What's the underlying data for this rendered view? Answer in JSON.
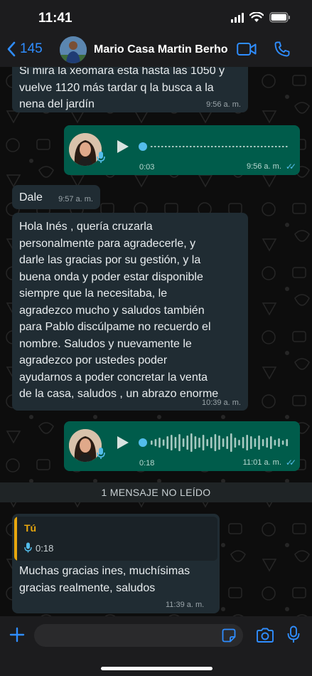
{
  "status_bar": {
    "time": "11:41"
  },
  "header": {
    "back_count": "145",
    "contact_name": "Mario Casa Martin Berho",
    "icons": [
      "back-chevron-icon",
      "video-call-icon",
      "phone-call-icon"
    ]
  },
  "messages": [
    {
      "type": "text",
      "direction": "incoming",
      "text": "Si mira la xeomara esta hasta las 1050 y\nvuelve 1120 más tardar q la busca a la\nnena del jardín",
      "time": "9:56 a. m."
    },
    {
      "type": "voice",
      "direction": "outgoing",
      "duration": "0:03",
      "time": "9:56 a. m.",
      "status": "read"
    },
    {
      "type": "text",
      "direction": "incoming",
      "text": "Dale",
      "time": "9:57 a. m."
    },
    {
      "type": "text",
      "direction": "incoming",
      "text": "Hola Inés , quería cruzarla\npersonalmente para agradecerle, y\ndarle las gracias por su gestión, y la\nbuena onda y poder estar disponible\nsiempre que la necesitaba, le\nagradezco mucho y saludos también\npara Pablo discúlpame no recuerdo el\nnombre. Saludos y nuevamente le\nagradezco por ustedes poder\nayudarnos a poder concretar la venta\nde la casa, saludos , un abrazo enorme",
      "time": "10:39 a. m."
    },
    {
      "type": "voice",
      "direction": "outgoing",
      "duration": "0:18",
      "time": "11:01 a. m.",
      "status": "read"
    },
    {
      "type": "text",
      "direction": "incoming",
      "quote": {
        "author": "Tú",
        "duration": "0:18"
      },
      "text": "Muchas gracias ines, muchísimas\ngracias realmente, saludos",
      "time": "11:39 a. m."
    }
  ],
  "unread_label": "1 MENSAJE NO LEÍDO",
  "colors": {
    "accent": "#2f8dff",
    "incoming_bubble": "#202c33",
    "outgoing_bubble": "#005c4b",
    "read_ticks": "#53bdeb",
    "quote_author": "#e8a70e"
  }
}
